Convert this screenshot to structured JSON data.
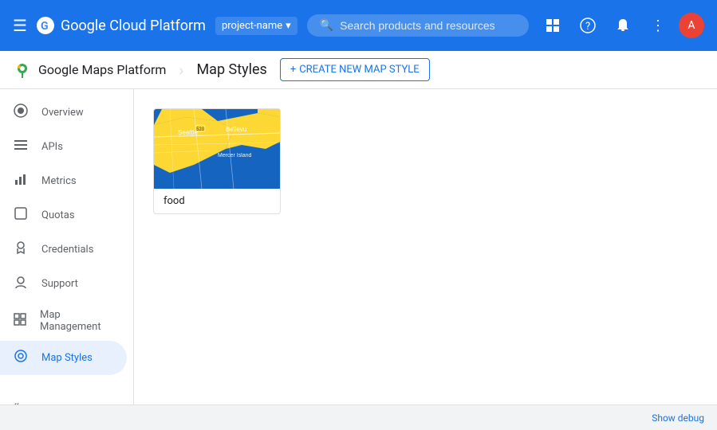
{
  "topbar": {
    "menu_icon": "☰",
    "logo_text": "Google Cloud Platform",
    "project_name": "project-name",
    "search_placeholder": "Search products and resources",
    "dropdown_icon": "▾",
    "icons": {
      "grid": "⊞",
      "help": "?",
      "bell": "🔔",
      "more": "⋮"
    },
    "avatar_letter": "A"
  },
  "subheader": {
    "app_name": "Google Maps Platform",
    "page_title": "Map Styles",
    "create_label": "CREATE NEW MAP STYLE",
    "plus_icon": "+"
  },
  "sidebar": {
    "items": [
      {
        "id": "overview",
        "label": "Overview",
        "icon": "⊙"
      },
      {
        "id": "apis",
        "label": "APIs",
        "icon": "☰"
      },
      {
        "id": "metrics",
        "label": "Metrics",
        "icon": "📊"
      },
      {
        "id": "quotas",
        "label": "Quotas",
        "icon": "⬜"
      },
      {
        "id": "credentials",
        "label": "Credentials",
        "icon": "🔑"
      },
      {
        "id": "support",
        "label": "Support",
        "icon": "👤"
      },
      {
        "id": "map-management",
        "label": "Map Management",
        "icon": "⊞"
      },
      {
        "id": "map-styles",
        "label": "Map Styles",
        "icon": "◎",
        "active": true
      }
    ],
    "collapse_icon": "«"
  },
  "map_styles": {
    "cards": [
      {
        "id": "food",
        "label": "food"
      }
    ]
  },
  "bottom_bar": {
    "label": "Show debug"
  }
}
